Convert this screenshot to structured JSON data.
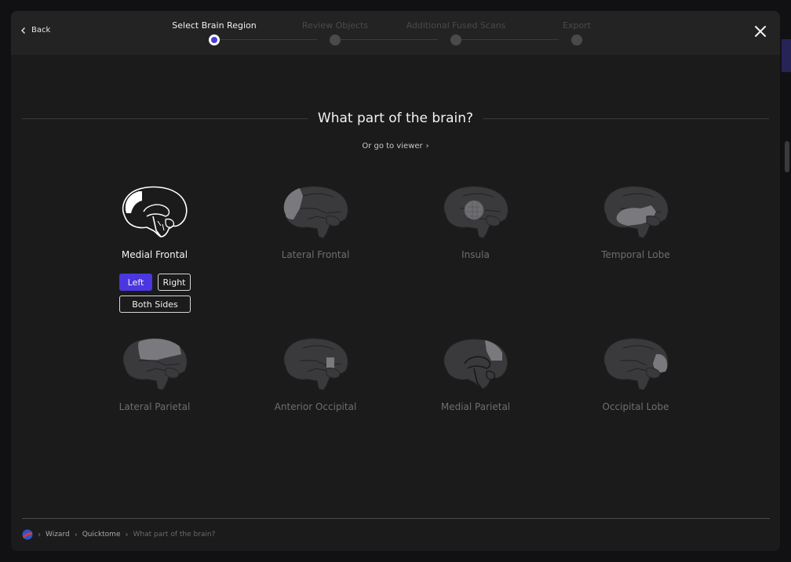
{
  "header": {
    "back_label": "Back",
    "steps": [
      {
        "label": "Select Brain Region",
        "state": "active"
      },
      {
        "label": "Review Objects",
        "state": "inactive"
      },
      {
        "label": "Additional Fused Scans",
        "state": "inactive"
      },
      {
        "label": "Export",
        "state": "inactive"
      }
    ]
  },
  "main": {
    "title": "What part of the brain?",
    "viewer_link": "Or go to viewer"
  },
  "regions": [
    {
      "label": "Medial Frontal",
      "selected": true
    },
    {
      "label": "Lateral Frontal",
      "selected": false
    },
    {
      "label": "Insula",
      "selected": false
    },
    {
      "label": "Temporal Lobe",
      "selected": false
    },
    {
      "label": "Lateral Parietal",
      "selected": false
    },
    {
      "label": "Anterior Occipital",
      "selected": false
    },
    {
      "label": "Medial Parietal",
      "selected": false
    },
    {
      "label": "Occipital Lobe",
      "selected": false
    }
  ],
  "side_options": {
    "left": "Left",
    "right": "Right",
    "both": "Both Sides",
    "selected": "Left"
  },
  "breadcrumb": [
    "Wizard",
    "Quicktome",
    "What part of the brain?"
  ],
  "colors": {
    "accent": "#4b37e0",
    "panel": "#1b1b1c",
    "topbar": "#232324"
  }
}
